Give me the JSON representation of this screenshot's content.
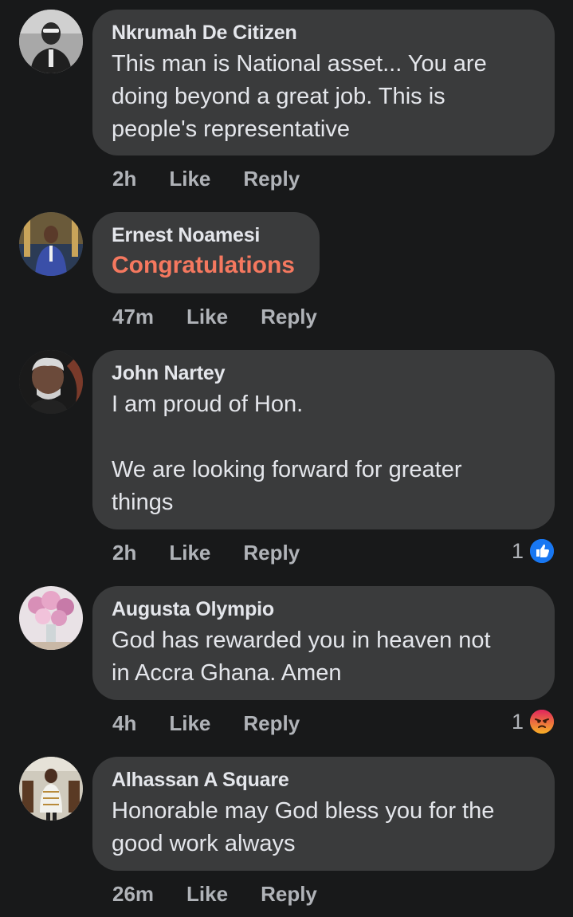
{
  "comments": [
    {
      "author": "Nkrumah De Citizen",
      "text": "This man is National asset... You are\ndoing beyond a great job. This is\npeople's representative",
      "time": "2h",
      "like": "Like",
      "reply": "Reply"
    },
    {
      "author": "Ernest Noamesi",
      "text": "Congratulations",
      "time": "47m",
      "like": "Like",
      "reply": "Reply"
    },
    {
      "author": "John Nartey",
      "text": "I am proud of Hon.\n\nWe are looking forward for greater\nthings",
      "time": "2h",
      "like": "Like",
      "reply": "Reply",
      "reaction_count": "1",
      "reaction_icon": "like-reaction-icon"
    },
    {
      "author": "Augusta Olympio",
      "text": "God has rewarded you in heaven not\nin Accra Ghana. Amen",
      "time": "4h",
      "like": "Like",
      "reply": "Reply",
      "reaction_count": "1",
      "reaction_icon": "angry-reaction-icon"
    },
    {
      "author": "Alhassan A Square",
      "text": "Honorable may God bless you for the\ngood work always",
      "time": "26m",
      "like": "Like",
      "reply": "Reply"
    }
  ],
  "colors": {
    "background": "#18191a",
    "bubble": "#3a3b3c",
    "text": "#e4e6eb",
    "meta": "#b0b3b8",
    "sticker_text": "#f5785f",
    "like_blue": "#1877f2",
    "angry_orange": "#f0632a"
  }
}
